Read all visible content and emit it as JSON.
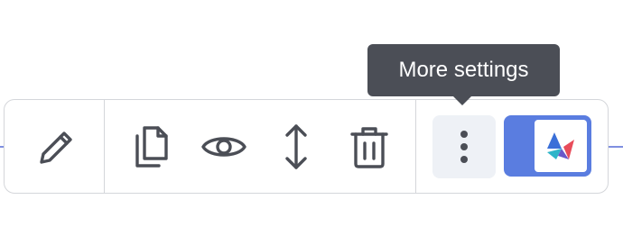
{
  "tooltip": {
    "text": "More settings"
  },
  "toolbar": {
    "tools": [
      {
        "id": "edit",
        "icon": "pencil-icon"
      },
      {
        "id": "duplicate",
        "icon": "copy-icon"
      },
      {
        "id": "preview",
        "icon": "eye-icon"
      },
      {
        "id": "move",
        "icon": "vertical-arrows-icon"
      },
      {
        "id": "delete",
        "icon": "trash-icon"
      },
      {
        "id": "more",
        "icon": "vertical-dots-icon"
      }
    ],
    "brand_icon": "app-logo-icon"
  },
  "colors": {
    "icon": "#4b4e56",
    "tooltip_bg": "#4b4e56",
    "border": "#d4d6da",
    "active_bg": "#eef1f6",
    "accent": "#5a7de0",
    "guide_line": "#7f8fe0"
  }
}
